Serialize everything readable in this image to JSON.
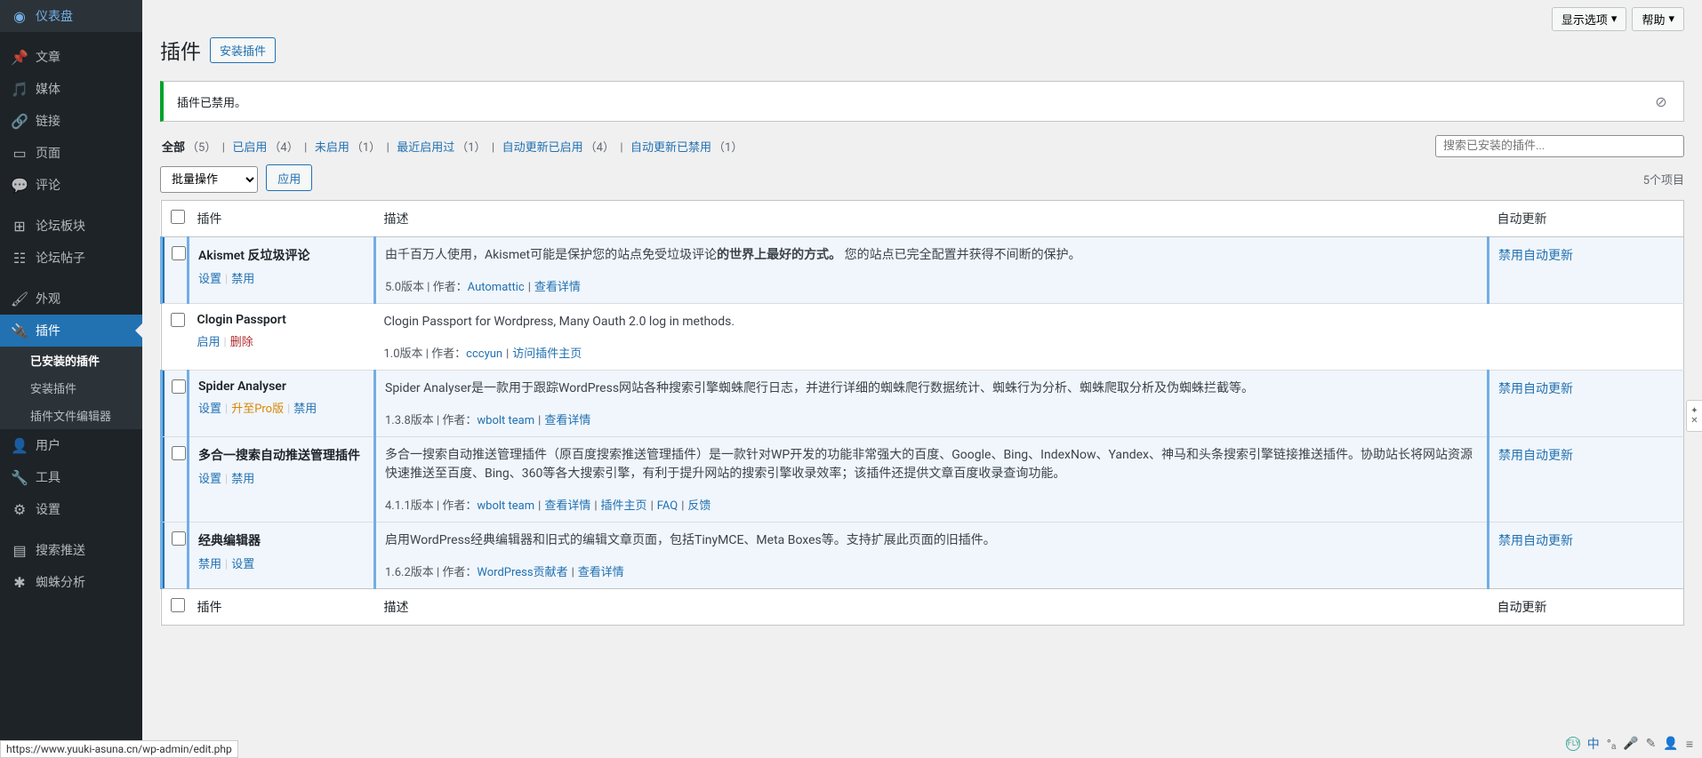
{
  "sidebar": {
    "items": [
      {
        "icon": "dashboard",
        "label": "仪表盘"
      },
      {
        "icon": "posts",
        "label": "文章"
      },
      {
        "icon": "media",
        "label": "媒体"
      },
      {
        "icon": "links",
        "label": "链接"
      },
      {
        "icon": "pages",
        "label": "页面"
      },
      {
        "icon": "comments",
        "label": "评论"
      },
      {
        "icon": "forum-boards",
        "label": "论坛板块"
      },
      {
        "icon": "forum-posts",
        "label": "论坛帖子"
      },
      {
        "icon": "appearance",
        "label": "外观"
      },
      {
        "icon": "plugins",
        "label": "插件"
      },
      {
        "icon": "users",
        "label": "用户"
      },
      {
        "icon": "tools",
        "label": "工具"
      },
      {
        "icon": "settings",
        "label": "设置"
      },
      {
        "icon": "search-push",
        "label": "搜索推送"
      },
      {
        "icon": "spider",
        "label": "蜘蛛分析"
      }
    ],
    "submenu": [
      {
        "label": "已安装的插件"
      },
      {
        "label": "安装插件"
      },
      {
        "label": "插件文件编辑器"
      }
    ]
  },
  "topbar": {
    "screen_options": "显示选项",
    "help": "帮助"
  },
  "header": {
    "title": "插件",
    "add_new": "安装插件"
  },
  "notice": {
    "message": "插件已禁用。"
  },
  "filters": {
    "all_label": "全部",
    "all_count": "（5）",
    "active_label": "已启用",
    "active_count": "（4）",
    "inactive_label": "未启用",
    "inactive_count": "（1）",
    "recent_label": "最近启用过",
    "recent_count": "（1）",
    "auto_on_label": "自动更新已启用",
    "auto_on_count": "（4）",
    "auto_off_label": "自动更新已禁用",
    "auto_off_count": "（1）"
  },
  "search": {
    "placeholder": "搜索已安装的插件..."
  },
  "bulk": {
    "label": "批量操作",
    "apply": "应用"
  },
  "displaying": "5个项目",
  "table": {
    "col_plugin": "插件",
    "col_desc": "描述",
    "col_auto": "自动更新"
  },
  "plugins": [
    {
      "active": true,
      "name": "Akismet 反垃圾评论",
      "actions": [
        {
          "label": "设置",
          "class": ""
        },
        {
          "label": "禁用",
          "class": ""
        }
      ],
      "desc_prefix": "由千百万人使用，Akismet可能是保护您的站点免受垃圾评论",
      "desc_bold": "的世界上最好的方式。",
      "desc_suffix": " 您的站点已完全配置并获得不间断的保护。",
      "meta": {
        "version": "5.0版本",
        "author_label": "作者：",
        "author": "Automattic",
        "links": [
          {
            "label": "查看详情"
          }
        ]
      },
      "auto": "禁用自动更新"
    },
    {
      "active": false,
      "name": "Clogin Passport",
      "actions": [
        {
          "label": "启用",
          "class": ""
        },
        {
          "label": "删除",
          "class": "delete"
        }
      ],
      "desc_prefix": "Clogin Passport for Wordpress, Many Oauth 2.0 log in methods.",
      "desc_bold": "",
      "desc_suffix": "",
      "meta": {
        "version": "1.0版本",
        "author_label": "作者：",
        "author": "cccyun",
        "links": [
          {
            "label": "访问插件主页"
          }
        ]
      },
      "auto": ""
    },
    {
      "active": true,
      "name": "Spider Analyser",
      "actions": [
        {
          "label": "设置",
          "class": ""
        },
        {
          "label": "升至Pro版",
          "class": "orange"
        },
        {
          "label": "禁用",
          "class": ""
        }
      ],
      "desc_prefix": "Spider Analyser是一款用于跟踪WordPress网站各种搜索引擎蜘蛛爬行日志，并进行详细的蜘蛛爬行数据统计、蜘蛛行为分析、蜘蛛爬取分析及伪蜘蛛拦截等。",
      "desc_bold": "",
      "desc_suffix": "",
      "meta": {
        "version": "1.3.8版本",
        "author_label": "作者：",
        "author": "wbolt team",
        "links": [
          {
            "label": "查看详情"
          }
        ]
      },
      "auto": "禁用自动更新"
    },
    {
      "active": true,
      "name": "多合一搜索自动推送管理插件",
      "actions": [
        {
          "label": "设置",
          "class": ""
        },
        {
          "label": "禁用",
          "class": ""
        }
      ],
      "desc_prefix": "多合一搜索自动推送管理插件（原百度搜索推送管理插件）是一款针对WP开发的功能非常强大的百度、Google、Bing、IndexNow、Yandex、神马和头条搜索引擎链接推送插件。协助站长将网站资源快速推送至百度、Bing、360等各大搜索引擎，有利于提升网站的搜索引擎收录效率；该插件还提供文章百度收录查询功能。",
      "desc_bold": "",
      "desc_suffix": "",
      "meta": {
        "version": "4.1.1版本",
        "author_label": "作者：",
        "author": "wbolt team",
        "links": [
          {
            "label": "查看详情"
          },
          {
            "label": "插件主页"
          },
          {
            "label": "FAQ"
          },
          {
            "label": "反馈"
          }
        ]
      },
      "auto": "禁用自动更新"
    },
    {
      "active": true,
      "name": "经典编辑器",
      "actions": [
        {
          "label": "禁用",
          "class": ""
        },
        {
          "label": "设置",
          "class": ""
        }
      ],
      "desc_prefix": "启用WordPress经典编辑器和旧式的编辑文章页面，包括TinyMCE、Meta Boxes等。支持扩展此页面的旧插件。",
      "desc_bold": "",
      "desc_suffix": "",
      "meta": {
        "version": "1.6.2版本",
        "author_label": "作者：",
        "author": "WordPress贡献者",
        "links": [
          {
            "label": "查看详情"
          }
        ]
      },
      "auto": "禁用自动更新"
    }
  ],
  "status_url": "https://www.yuuki-asuna.cn/wp-admin/edit.php"
}
